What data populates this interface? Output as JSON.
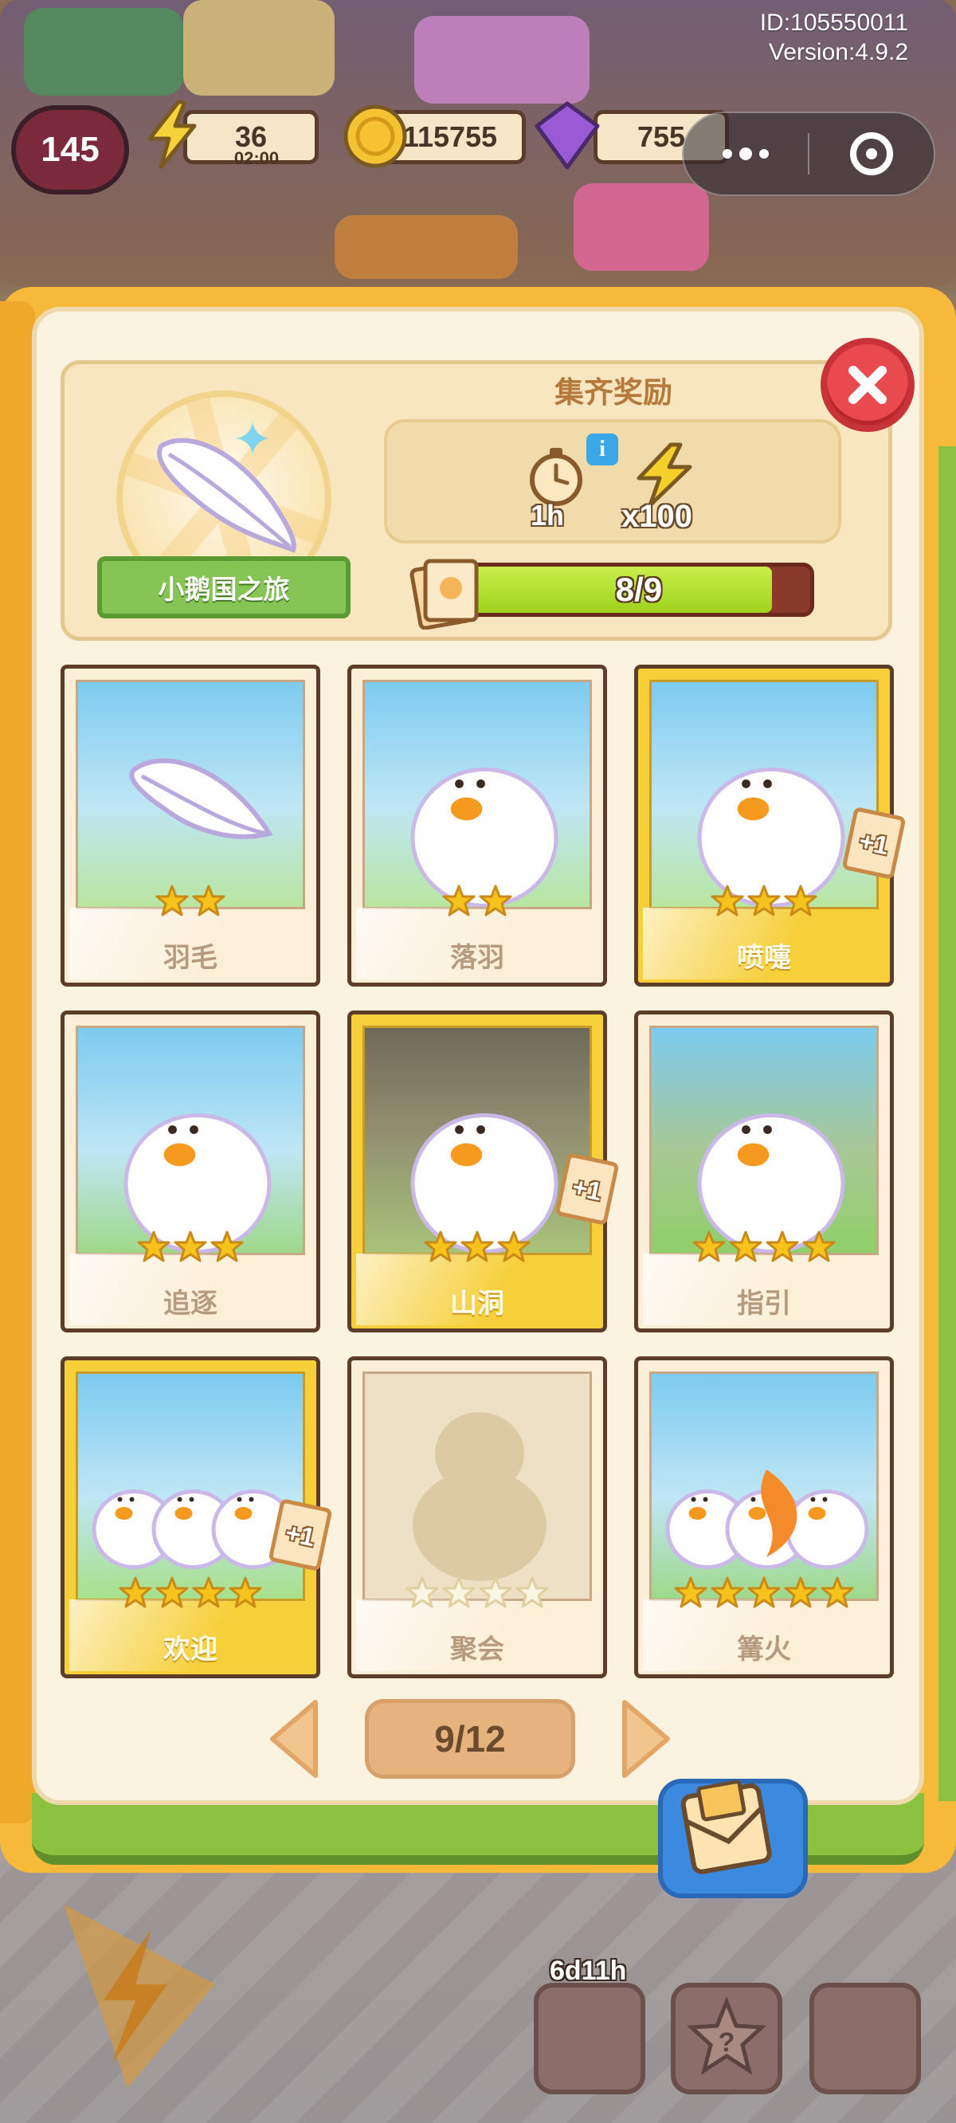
{
  "system": {
    "id_text": "ID:105550011",
    "version_text": "Version:4.9.2"
  },
  "hud": {
    "level": "145",
    "energy": "36",
    "energy_timer": "02:00",
    "coins": "115755",
    "gems": "755"
  },
  "album": {
    "collection_name": "小鹅国之旅",
    "reward_title": "集齐奖励",
    "reward_time": "1h",
    "reward_multiplier": "x100",
    "progress_text": "8/9",
    "progress_value": 0.889,
    "page_indicator": "9/12"
  },
  "cards": [
    {
      "name": "羽毛",
      "stars": 2,
      "gold": false,
      "plus_one": null,
      "owned": true
    },
    {
      "name": "落羽",
      "stars": 2,
      "gold": false,
      "plus_one": null,
      "owned": true
    },
    {
      "name": "喷嚏",
      "stars": 3,
      "gold": true,
      "plus_one": "+1",
      "owned": true
    },
    {
      "name": "追逐",
      "stars": 3,
      "gold": false,
      "plus_one": null,
      "owned": true
    },
    {
      "name": "山洞",
      "stars": 3,
      "gold": true,
      "plus_one": "+1",
      "owned": true
    },
    {
      "name": "指引",
      "stars": 4,
      "gold": false,
      "plus_one": null,
      "owned": true
    },
    {
      "name": "欢迎",
      "stars": 4,
      "gold": true,
      "plus_one": "+1",
      "owned": true
    },
    {
      "name": "聚会",
      "stars": 4,
      "gold": false,
      "plus_one": null,
      "owned": false
    },
    {
      "name": "篝火",
      "stars": 5,
      "gold": false,
      "plus_one": null,
      "owned": true
    }
  ],
  "bottom": {
    "event_timer": "6d11h"
  },
  "colors": {
    "star": "#f6c21c",
    "star_empty": "#fbf5e4",
    "progress_fill": "#a6d824",
    "gold_card": "#f6cf39",
    "close_red": "#e84a4f"
  }
}
